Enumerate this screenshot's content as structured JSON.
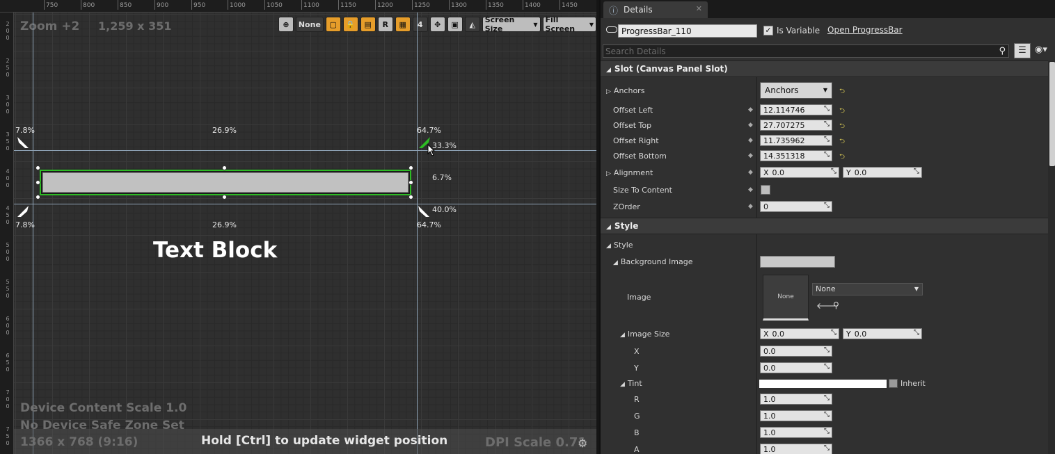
{
  "designer": {
    "ruler_top": [
      "750",
      "800",
      "850",
      "900",
      "950",
      "1000",
      "1050",
      "1100",
      "1150",
      "1200",
      "1250",
      "1300",
      "1350",
      "1400",
      "1450"
    ],
    "ruler_left": [
      "2\n0\n0",
      "2\n5\n0",
      "3\n0\n0",
      "3\n5\n0",
      "4\n0\n0",
      "4\n5\n0",
      "5\n0\n0",
      "5\n5\n0",
      "6\n0\n0",
      "6\n5\n0",
      "7\n0\n0",
      "7\n5\n0"
    ],
    "zoom_label": "Zoom +2",
    "resolution_label": "1,259 x 351",
    "toolbar": {
      "none_label": "None",
      "r_label": "R",
      "grid_snap_value": "4",
      "screen_size_label": "Screen Size",
      "fill_screen_label": "Fill Screen"
    },
    "guides": {
      "top_left_pct": "7.8%",
      "top_mid_pct": "26.9%",
      "top_right_pct": "64.7%",
      "right_upper_pct": "33.3%",
      "right_mid_pct": "6.7%",
      "right_lower_pct": "40.0%",
      "bottom_left_pct": "7.8%",
      "bottom_mid_pct": "26.9%",
      "bottom_right_pct": "64.7%"
    },
    "text_block": "Text Block",
    "device_content_scale": "Device Content Scale 1.0",
    "safe_zone": "No Device Safe Zone Set",
    "screen_resolution": "1366 x 768 (9:16)",
    "hint": "Hold [Ctrl] to update widget position",
    "dpi_scale": "DPI Scale 0.71"
  },
  "details": {
    "tab_title": "Details",
    "widget_name": "ProgressBar_110",
    "is_variable_label": "Is Variable",
    "is_variable_checked": "✓",
    "open_link": "Open ProgressBar",
    "search_placeholder": "Search Details",
    "slot_category": "Slot (Canvas Panel Slot)",
    "anchors_label": "Anchors",
    "anchors_value": "Anchors",
    "offset_left_label": "Offset Left",
    "offset_left": "12.114746",
    "offset_top_label": "Offset Top",
    "offset_top": "27.707275",
    "offset_right_label": "Offset Right",
    "offset_right": "11.735962",
    "offset_bottom_label": "Offset Bottom",
    "offset_bottom": "14.351318",
    "alignment_label": "Alignment",
    "alignment_x": "0.0",
    "alignment_y": "0.0",
    "size_to_content_label": "Size To Content",
    "zorder_label": "ZOrder",
    "zorder": "0",
    "style_category": "Style",
    "style_group": "Style",
    "background_image_label": "Background Image",
    "image_label": "Image",
    "image_thumb_text": "None",
    "image_value": "None",
    "image_size_label": "Image Size",
    "image_size_x": "0.0",
    "image_size_y": "0.0",
    "x_label": "X",
    "x_value": "0.0",
    "y_label": "Y",
    "y_value": "0.0",
    "tint_label": "Tint",
    "inherit_label": "Inherit",
    "r_label": "R",
    "r_value": "1.0",
    "g_label": "G",
    "g_value": "1.0",
    "b_label": "B",
    "b_value": "1.0",
    "a_label": "A",
    "a_value": "1.0"
  },
  "colors": {
    "selection_green": "#2dbb24",
    "toolbar_orange": "#e69d2a",
    "reset_yellow": "#dccc55"
  }
}
